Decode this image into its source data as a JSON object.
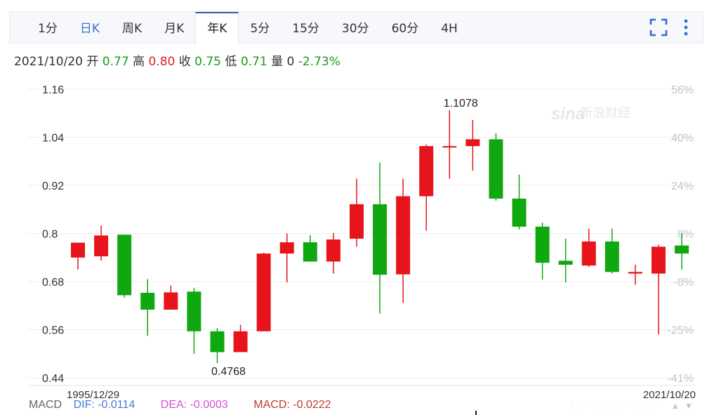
{
  "tabs": [
    {
      "label": "1分",
      "blue": false,
      "active": false
    },
    {
      "label": "日K",
      "blue": true,
      "active": false
    },
    {
      "label": "周K",
      "blue": false,
      "active": false
    },
    {
      "label": "月K",
      "blue": false,
      "active": false
    },
    {
      "label": "年K",
      "blue": false,
      "active": true
    },
    {
      "label": "5分",
      "blue": false,
      "active": false
    },
    {
      "label": "15分",
      "blue": false,
      "active": false
    },
    {
      "label": "30分",
      "blue": false,
      "active": false
    },
    {
      "label": "60分",
      "blue": false,
      "active": false
    },
    {
      "label": "4H",
      "blue": false,
      "active": false
    }
  ],
  "toolbar": {
    "expand_icon": "fullscreen-icon",
    "more_icon": "more-vertical-icon"
  },
  "quote": {
    "date": "2021/10/20",
    "open_label": "开",
    "open": "0.77",
    "high_label": "高",
    "high": "0.80",
    "close_label": "收",
    "close": "0.75",
    "low_label": "低",
    "low": "0.71",
    "volume_label": "量",
    "volume": "0",
    "change": "-2.73%"
  },
  "watermark": {
    "brand": "sina",
    "name": "新浪财经"
  },
  "macd": {
    "label": "MACD",
    "dif": "DIF: -0.0114",
    "dea": "DEA: -0.0003",
    "macd": "MACD: -0.0222"
  },
  "scroll": {
    "up": "▲",
    "down": "▼"
  },
  "colors": {
    "up": "#e8141c",
    "down": "#10a810",
    "grid": "#eceef1",
    "axis_text": "#333333",
    "pct_text": "#c0c4cc",
    "dif": "#4a78d8",
    "dea": "#d64fd6",
    "macd": "#c0392b"
  },
  "chart_data": {
    "type": "candlestick",
    "y_ticks": [
      "1.16",
      "1.04",
      "0.92",
      "0.8",
      "0.68",
      "0.56",
      "0.44"
    ],
    "y_tick_values": [
      1.16,
      1.04,
      0.92,
      0.8,
      0.68,
      0.56,
      0.44
    ],
    "ylim": [
      0.44,
      1.16
    ],
    "pct_ticks": [
      "56%",
      "40%",
      "24%",
      "8%",
      "-8%",
      "-25%",
      "-41%"
    ],
    "x_start_label": "1995/12/29",
    "x_end_label": "2021/10/20",
    "max_label": "1.1078",
    "min_label": "0.4768",
    "candles": [
      {
        "o": 0.74,
        "c": 0.777,
        "h": 0.777,
        "l": 0.71
      },
      {
        "o": 0.743,
        "c": 0.795,
        "h": 0.82,
        "l": 0.732
      },
      {
        "o": 0.797,
        "c": 0.646,
        "h": 0.797,
        "l": 0.64
      },
      {
        "o": 0.652,
        "c": 0.61,
        "h": 0.686,
        "l": 0.545
      },
      {
        "o": 0.61,
        "c": 0.653,
        "h": 0.67,
        "l": 0.61
      },
      {
        "o": 0.655,
        "c": 0.556,
        "h": 0.664,
        "l": 0.5
      },
      {
        "o": 0.556,
        "c": 0.504,
        "h": 0.564,
        "l": 0.4768
      },
      {
        "o": 0.504,
        "c": 0.556,
        "h": 0.572,
        "l": 0.504
      },
      {
        "o": 0.556,
        "c": 0.75,
        "h": 0.752,
        "l": 0.556
      },
      {
        "o": 0.75,
        "c": 0.778,
        "h": 0.8,
        "l": 0.678
      },
      {
        "o": 0.778,
        "c": 0.73,
        "h": 0.796,
        "l": 0.73
      },
      {
        "o": 0.73,
        "c": 0.785,
        "h": 0.801,
        "l": 0.7
      },
      {
        "o": 0.787,
        "c": 0.873,
        "h": 0.937,
        "l": 0.767
      },
      {
        "o": 0.873,
        "c": 0.697,
        "h": 0.977,
        "l": 0.6
      },
      {
        "o": 0.698,
        "c": 0.893,
        "h": 0.937,
        "l": 0.627
      },
      {
        "o": 0.893,
        "c": 1.018,
        "h": 1.022,
        "l": 0.807
      },
      {
        "o": 1.018,
        "c": 1.018,
        "h": 1.1078,
        "l": 0.937
      },
      {
        "o": 1.018,
        "c": 1.035,
        "h": 1.083,
        "l": 0.957
      },
      {
        "o": 1.035,
        "c": 0.887,
        "h": 1.05,
        "l": 0.882
      },
      {
        "o": 0.887,
        "c": 0.817,
        "h": 0.947,
        "l": 0.81
      },
      {
        "o": 0.817,
        "c": 0.727,
        "h": 0.827,
        "l": 0.685
      },
      {
        "o": 0.732,
        "c": 0.722,
        "h": 0.787,
        "l": 0.678
      },
      {
        "o": 0.72,
        "c": 0.78,
        "h": 0.812,
        "l": 0.717
      },
      {
        "o": 0.78,
        "c": 0.704,
        "h": 0.812,
        "l": 0.7
      },
      {
        "o": 0.7,
        "c": 0.704,
        "h": 0.722,
        "l": 0.672
      },
      {
        "o": 0.7,
        "c": 0.767,
        "h": 0.772,
        "l": 0.548
      },
      {
        "o": 0.77,
        "c": 0.75,
        "h": 0.8,
        "l": 0.71
      }
    ]
  }
}
